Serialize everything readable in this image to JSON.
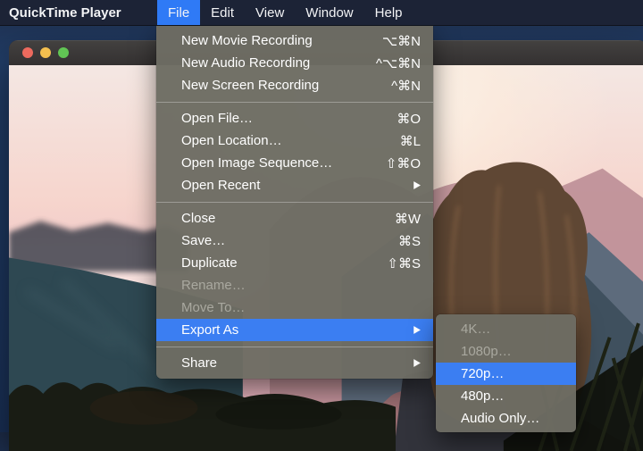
{
  "colors": {
    "menubar_bg": "#1c2336",
    "menu_bg": "#6d6c63",
    "menu_highlight": "#3b7ef2",
    "disabled_text": "#a9a89f",
    "traffic_red": "#ed6a5e",
    "traffic_yellow": "#f4bf4f",
    "traffic_green": "#61c554"
  },
  "menu_bar": {
    "app_name": "QuickTime Player",
    "items": [
      {
        "label": "File",
        "active": true
      },
      {
        "label": "Edit",
        "active": false
      },
      {
        "label": "View",
        "active": false
      },
      {
        "label": "Window",
        "active": false
      },
      {
        "label": "Help",
        "active": false
      }
    ]
  },
  "window": {
    "traffic_lights": [
      "close",
      "minimize",
      "zoom"
    ]
  },
  "file_menu": {
    "items": [
      {
        "label": "New Movie Recording",
        "shortcut": "⌥⌘N"
      },
      {
        "label": "New Audio Recording",
        "shortcut": "^⌥⌘N"
      },
      {
        "label": "New Screen Recording",
        "shortcut": "^⌘N"
      },
      {
        "label": "Open File…",
        "shortcut": "⌘O"
      },
      {
        "label": "Open Location…",
        "shortcut": "⌘L"
      },
      {
        "label": "Open Image Sequence…",
        "shortcut": "⇧⌘O"
      },
      {
        "label": "Open Recent",
        "has_submenu": true
      },
      {
        "label": "Close",
        "shortcut": "⌘W"
      },
      {
        "label": "Save…",
        "shortcut": "⌘S"
      },
      {
        "label": "Duplicate",
        "shortcut": "⇧⌘S"
      },
      {
        "label": "Rename…",
        "disabled": true
      },
      {
        "label": "Move To…",
        "disabled": true
      },
      {
        "label": "Export As",
        "has_submenu": true,
        "highlighted": true
      },
      {
        "label": "Share",
        "has_submenu": true
      }
    ]
  },
  "export_submenu": {
    "items": [
      {
        "label": "4K…",
        "disabled": true
      },
      {
        "label": "1080p…",
        "disabled": true
      },
      {
        "label": "720p…",
        "highlighted": true
      },
      {
        "label": "480p…"
      },
      {
        "label": "Audio Only…"
      }
    ]
  },
  "icons": {
    "submenu_arrow": "▶"
  }
}
